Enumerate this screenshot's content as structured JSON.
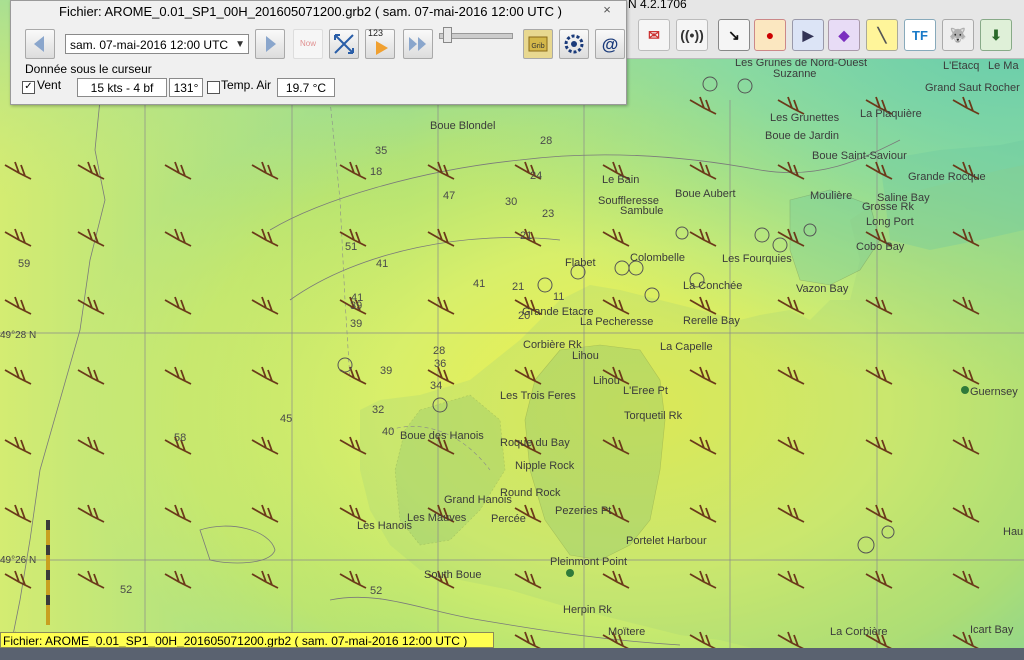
{
  "app": {
    "title_fragment": "N 4.2.1706",
    "status_bar_text": "Fichier: AROME_0.01_SP1_00H_201605071200.grb2 ( sam. 07-mai-2016 12:00  UTC )"
  },
  "grib_dialog": {
    "title": "Fichier: AROME_0.01_SP1_00H_201605071200.grb2 ( sam. 07-mai-2016 12:00  UTC )",
    "close_label": "×",
    "selected_time": "sam. 07-mai-2016 12:00  UTC",
    "now_label": "Now",
    "step_label": "123",
    "cursor_data_label": "Donnée sous le curseur",
    "wind": {
      "label": "Vent",
      "checked": true,
      "speed": "15 kts -  4 bf",
      "direction": "131°"
    },
    "temp_air": {
      "label": "Temp. Air",
      "checked": false,
      "value": "19.7 °C"
    }
  },
  "colors": {
    "map_yellow": "#e8f060",
    "map_green": "#a8e070",
    "map_teal": "#7ed8a8",
    "status_bar": "#ffff50",
    "wind_barb": "#6b3a1a"
  },
  "map": {
    "place_names": [
      "Les Grunes de Nord-Ouest",
      "Suzanne",
      "L'Etacq",
      "Le Ma",
      "Grand Saut Rocher",
      "Les Grunettes",
      "La Plaquière",
      "Boue Blondel",
      "Boue Saint-Saviour",
      "Boue de Jardin",
      "Le Bain",
      "Boue Aubert",
      "Moulière",
      "Grande Rocque",
      "Souffleresse",
      "Sambule",
      "Saline Bay",
      "Grosse Rk",
      "Long Port",
      "Cobo Bay",
      "Colombelle",
      "Les Fourquies",
      "Flabet",
      "La Conchée",
      "Vazon Bay",
      "Grande Etacre",
      "La Pecheresse",
      "Rerelle Bay",
      "Corbière Rk",
      "Lihou",
      "La Capelle",
      "Lihou",
      "L'Eree Pt",
      "Les Trois Feres",
      "Torquetil Rk",
      "Guernsey",
      "Boue des Hanois",
      "Roque du Bay",
      "Nipple Rock",
      "Round Rock",
      "Grand Hanois",
      "Pezeries Pt",
      "Les Hanois",
      "Les Mauves",
      "Percée",
      "Portelet Harbour",
      "Pleinmont Point",
      "South Boue",
      "Herpin Rk",
      "Moïtere",
      "La Corbière",
      "Icart Bay",
      "Hau"
    ],
    "depths": [
      "35",
      "28",
      "18",
      "47",
      "30",
      "41",
      "59",
      "39",
      "45",
      "51",
      "41",
      "39",
      "39",
      "32",
      "28",
      "58",
      "40",
      "41",
      "52",
      "21",
      "20",
      "11",
      "34",
      "36",
      "24",
      "23",
      "21",
      "52"
    ],
    "lat_labels": [
      "49°28 N",
      "49°26 N"
    ]
  },
  "toolbar": {
    "icons": [
      "weather-fax-icon",
      "gps-antenna-icon",
      "route-arrow-icon",
      "grib-globe-icon",
      "track-icon",
      "waypoint-purple-icon",
      "measure-ruler-icon",
      "tide-font-icon",
      "dog-icon",
      "download-icon",
      "more-icon"
    ]
  }
}
